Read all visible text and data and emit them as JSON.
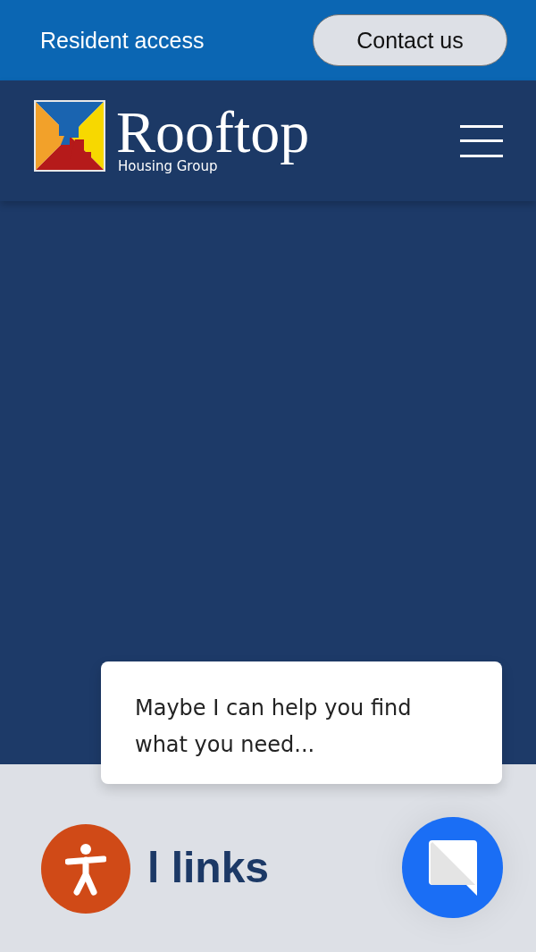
{
  "top_bar": {
    "link": "Resident access",
    "button": "Contact us"
  },
  "header": {
    "logo_name": "Rooftop",
    "logo_tagline": "Housing Group"
  },
  "chat_prompt": {
    "message": "Maybe I can help you find what you need..."
  },
  "section": {
    "heading_visible": "l links"
  }
}
